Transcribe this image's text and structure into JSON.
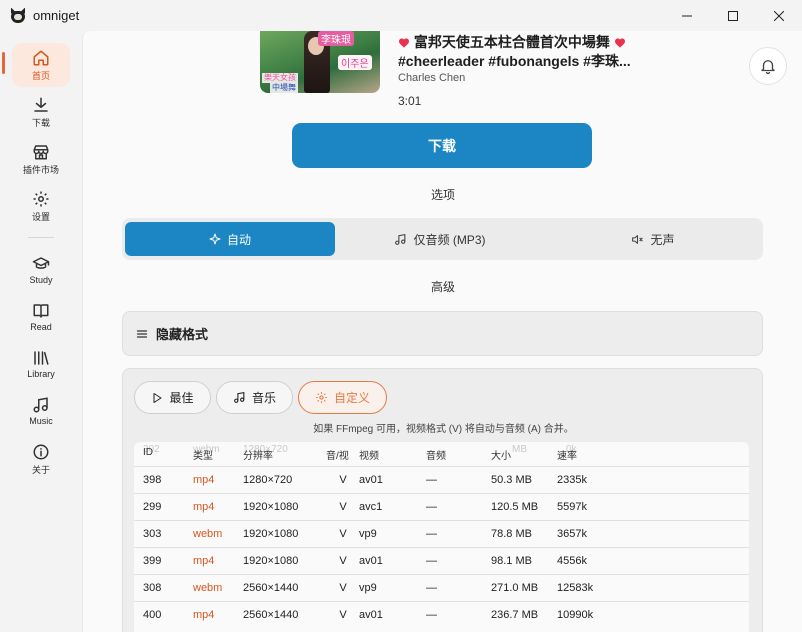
{
  "window": {
    "title": "omniget",
    "controls": {
      "minimize": "minimize-icon",
      "maximize": "maximize-icon",
      "close": "close-icon"
    }
  },
  "sidebar": {
    "items": [
      {
        "label": "首页",
        "icon": "home-icon",
        "active": true
      },
      {
        "label": "下载",
        "icon": "download-icon"
      },
      {
        "label": "插件市场",
        "icon": "store-icon"
      },
      {
        "label": "设置",
        "icon": "gear-icon"
      },
      {
        "label": "Study",
        "icon": "graduation-cap-icon"
      },
      {
        "label": "Read",
        "icon": "book-icon"
      },
      {
        "label": "Library",
        "icon": "library-icon"
      },
      {
        "label": "Music",
        "icon": "music-note-icon"
      },
      {
        "label": "关于",
        "icon": "info-icon"
      }
    ]
  },
  "video": {
    "thumb_text": [
      "李珠珢",
      "이주은",
      "樂天女孩",
      "中場舞"
    ],
    "title_line1": "富邦天使五本柱合體首次中場舞",
    "title_line2": "#cheerleader #fubonangels #李珠...",
    "author": "Charles Chen",
    "duration": "3:01"
  },
  "download_button": "下载",
  "options_label": "选项",
  "modes": [
    {
      "label": "自动",
      "icon": "sparkle-icon",
      "active": true
    },
    {
      "label": "仅音频 (MP3)",
      "icon": "music-note-icon",
      "active": false
    },
    {
      "label": "无声",
      "icon": "mute-icon",
      "active": false
    }
  ],
  "advanced_label": "高级",
  "hide_formats_label": "隐藏格式",
  "presets": [
    {
      "label": "最佳",
      "icon": "play-icon",
      "active": false
    },
    {
      "label": "音乐",
      "icon": "music-note-icon",
      "active": false
    },
    {
      "label": "自定义",
      "icon": "gear-icon",
      "active": true
    }
  ],
  "hint": "如果 FFmpeg 可用，视频格式 (V) 将自动与音频 (A) 合并。",
  "formats_table": {
    "ghost_row": [
      "302",
      "webm",
      "1280×720",
      "MB",
      "0k"
    ],
    "headers": [
      "ID",
      "类型",
      "分辨率",
      "音/视",
      "视频",
      "音频",
      "大小",
      "速率"
    ],
    "rows": [
      [
        "398",
        "mp4",
        "1280×720",
        "V",
        "av01",
        "—",
        "50.3 MB",
        "2335k"
      ],
      [
        "299",
        "mp4",
        "1920×1080",
        "V",
        "avc1",
        "—",
        "120.5 MB",
        "5597k"
      ],
      [
        "303",
        "webm",
        "1920×1080",
        "V",
        "vp9",
        "—",
        "78.8 MB",
        "3657k"
      ],
      [
        "399",
        "mp4",
        "1920×1080",
        "V",
        "av01",
        "—",
        "98.1 MB",
        "4556k"
      ],
      [
        "308",
        "webm",
        "2560×1440",
        "V",
        "vp9",
        "—",
        "271.0 MB",
        "12583k"
      ],
      [
        "400",
        "mp4",
        "2560×1440",
        "V",
        "av01",
        "—",
        "236.7 MB",
        "10990k"
      ]
    ]
  },
  "colors": {
    "accent": "#1c86c5",
    "active_nav": "#e8673b",
    "ext": "#d4571f"
  }
}
